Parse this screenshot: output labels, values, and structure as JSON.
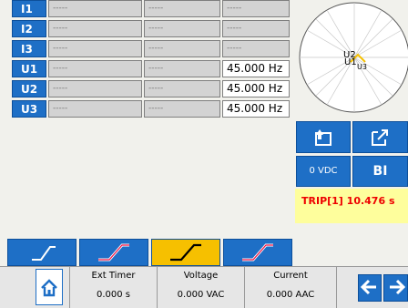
{
  "channels": [
    {
      "name": "I1",
      "c1": "-----",
      "c2": "-----",
      "c3": "-----"
    },
    {
      "name": "I2",
      "c1": "-----",
      "c2": "-----",
      "c3": "-----"
    },
    {
      "name": "I3",
      "c1": "-----",
      "c2": "-----",
      "c3": "-----"
    },
    {
      "name": "U1",
      "c1": "-----",
      "c2": "-----",
      "c3": "45.000 Hz"
    },
    {
      "name": "U2",
      "c1": "-----",
      "c2": "-----",
      "c3": "45.000 Hz"
    },
    {
      "name": "U3",
      "c1": "-----",
      "c2": "-----",
      "c3": "45.000 Hz"
    }
  ],
  "polar": {
    "label_a": "U2",
    "label_b": "U1",
    "label_c": "U3"
  },
  "buttons": {
    "dc": "0 VDC",
    "bi": "BI"
  },
  "trip": "TRIP[1] 10.476 s",
  "status": [
    {
      "title": "Ext Timer",
      "value": "0.000 s"
    },
    {
      "title": "Voltage",
      "value": "0.000 VAC"
    },
    {
      "title": "Current",
      "value": "0.000 AAC"
    }
  ],
  "colors": {
    "accent": "#1e6fc6",
    "active_tab": "#f6c000",
    "trip_bg": "#fefe9c",
    "trip_text": "#ee0000"
  },
  "icons": [
    "export-icon",
    "open-external-icon",
    "home-icon",
    "arrow-left-icon",
    "arrow-right-icon",
    "ramp-icon"
  ]
}
